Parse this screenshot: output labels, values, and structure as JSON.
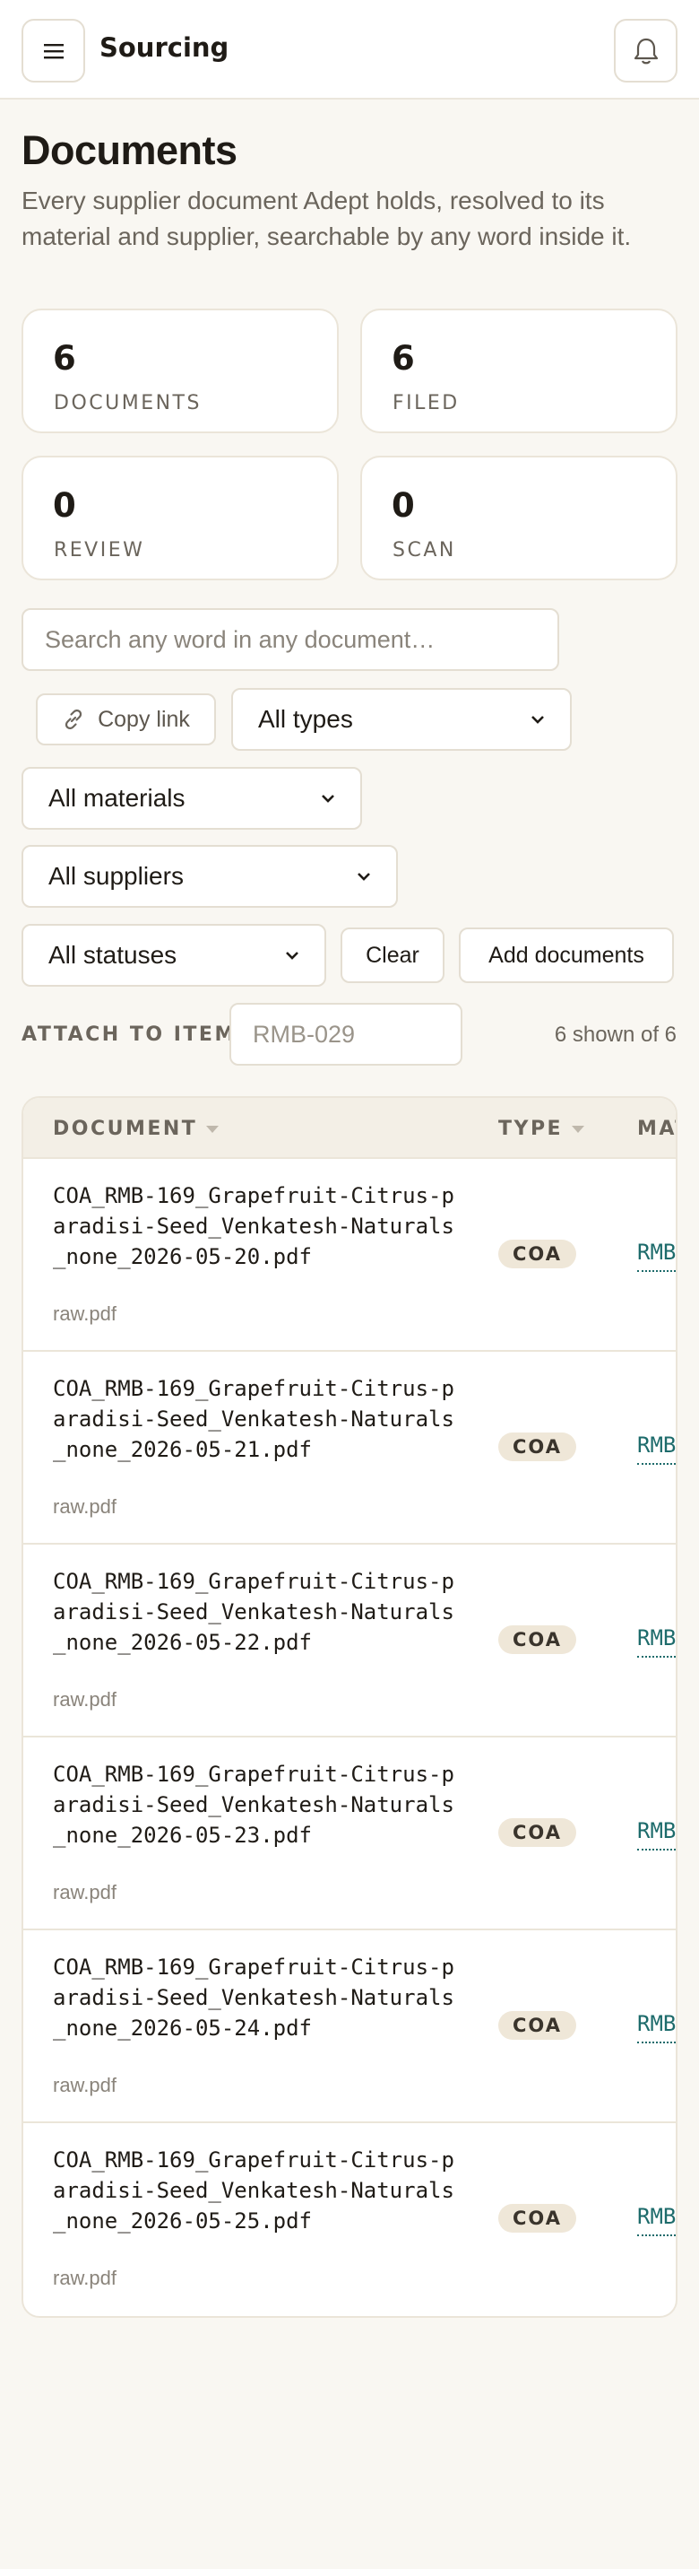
{
  "header": {
    "brand": "Sourcing",
    "menu_icon": "menu-icon",
    "bell_icon": "bell-icon"
  },
  "page": {
    "title": "Documents",
    "subtitle": "Every supplier document Adept holds, resolved to its material and supplier, searchable by any word inside it."
  },
  "stats": [
    {
      "value": "6",
      "label": "DOCUMENTS"
    },
    {
      "value": "6",
      "label": "FILED"
    },
    {
      "value": "0",
      "label": "REVIEW"
    },
    {
      "value": "0",
      "label": "SCAN"
    }
  ],
  "filters": {
    "search_placeholder": "Search any word in any document…",
    "copy_link": "Copy link",
    "type": "All types",
    "materials": "All materials",
    "suppliers": "All suppliers",
    "statuses": "All statuses",
    "clear": "Clear",
    "add_documents": "Add documents"
  },
  "attach": {
    "label": "ATTACH TO ITEM",
    "placeholder": "RMB-029",
    "count": "6 shown of 6"
  },
  "table": {
    "columns": [
      "DOCUMENT",
      "TYPE",
      "MAT"
    ],
    "rows": [
      {
        "file": "COA_RMB-169_Grapefruit-Citrus-paradisi-Seed_Venkatesh-Naturals_none_2026-05-20.pdf",
        "sub": "raw.pdf",
        "type": "COA",
        "material": "RMB"
      },
      {
        "file": "COA_RMB-169_Grapefruit-Citrus-paradisi-Seed_Venkatesh-Naturals_none_2026-05-21.pdf",
        "sub": "raw.pdf",
        "type": "COA",
        "material": "RMB"
      },
      {
        "file": "COA_RMB-169_Grapefruit-Citrus-paradisi-Seed_Venkatesh-Naturals_none_2026-05-22.pdf",
        "sub": "raw.pdf",
        "type": "COA",
        "material": "RMB"
      },
      {
        "file": "COA_RMB-169_Grapefruit-Citrus-paradisi-Seed_Venkatesh-Naturals_none_2026-05-23.pdf",
        "sub": "raw.pdf",
        "type": "COA",
        "material": "RMB"
      },
      {
        "file": "COA_RMB-169_Grapefruit-Citrus-paradisi-Seed_Venkatesh-Naturals_none_2026-05-24.pdf",
        "sub": "raw.pdf",
        "type": "COA",
        "material": "RMB"
      },
      {
        "file": "COA_RMB-169_Grapefruit-Citrus-paradisi-Seed_Venkatesh-Naturals_none_2026-05-25.pdf",
        "sub": "raw.pdf",
        "type": "COA",
        "material": "RMB"
      }
    ]
  },
  "colors": {
    "background": "#f9f7f2",
    "accent_link": "#1d6b6b",
    "badge": "#efe7d8"
  }
}
